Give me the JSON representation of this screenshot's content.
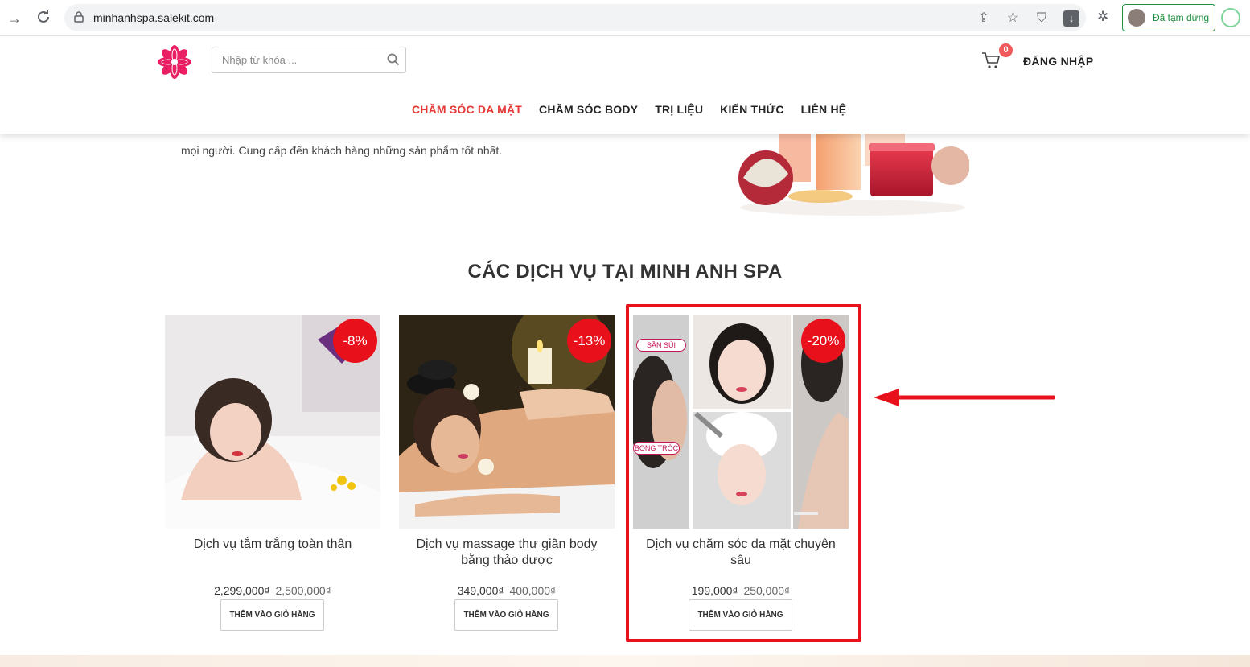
{
  "browser": {
    "url": "minhanhspa.salekit.com",
    "profile_status": "Đã tạm dừng"
  },
  "header": {
    "search_placeholder": "Nhập từ khóa ...",
    "cart_count": "0",
    "login_label": "ĐĂNG NHẬP",
    "nav": [
      {
        "label": "CHĂM SÓC DA MẶT",
        "active": true
      },
      {
        "label": "CHĂM SÓC BODY",
        "active": false
      },
      {
        "label": "TRỊ LIỆU",
        "active": false
      },
      {
        "label": "KIẾN THỨC",
        "active": false
      },
      {
        "label": "LIÊN HỆ",
        "active": false
      }
    ]
  },
  "intro": {
    "text": "mọi người. Cung cấp đến khách hàng những sản phẩm tốt nhất."
  },
  "services": {
    "title": "CÁC DỊCH VỤ TẠI MINH ANH SPA",
    "products": [
      {
        "name": "Dịch vụ tắm trắng toàn thân",
        "discount": "-8%",
        "price": "2,299,000₫",
        "old_price": "2,500,000₫",
        "button": "THÊM VÀO GIỎ HÀNG"
      },
      {
        "name": "Dịch vụ massage thư giãn body bằng thảo dược",
        "discount": "-13%",
        "price": "349,000₫",
        "old_price": "400,000₫",
        "button": "THÊM VÀO GIỎ HÀNG"
      },
      {
        "name": "Dịch vụ chăm sóc da mặt chuyên sâu",
        "discount": "-20%",
        "price": "199,000₫",
        "old_price": "250,000₫",
        "button": "THÊM VÀO GIỎ HÀNG",
        "image_labels": [
          "SẦN SÙI",
          "BONG TRÓC"
        ]
      }
    ]
  },
  "colors": {
    "accent": "#e53935",
    "badge": "#e8101a",
    "highlight": "#e8101a"
  }
}
